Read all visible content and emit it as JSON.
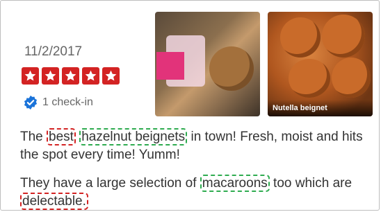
{
  "review": {
    "date": "11/2/2017",
    "rating": 5,
    "checkin_text": "1 check-in",
    "photos": [
      {
        "caption": ""
      },
      {
        "caption": "Nutella beignet"
      }
    ],
    "paragraph1": {
      "pre": "The ",
      "w1": "best",
      "sp1": " ",
      "w2": "hazelnut beignets",
      "post": " in town! Fresh, moist and hits the spot every time! Yumm!"
    },
    "paragraph2": {
      "pre": "They have a large selection of ",
      "w1": "macaroons",
      "mid": " too which are ",
      "w2": "delectable."
    }
  },
  "colors": {
    "star_red": "#d32323",
    "highlight_red": "#d32323",
    "highlight_green": "#2eab4f",
    "checkin_blue": "#1a73d9"
  }
}
